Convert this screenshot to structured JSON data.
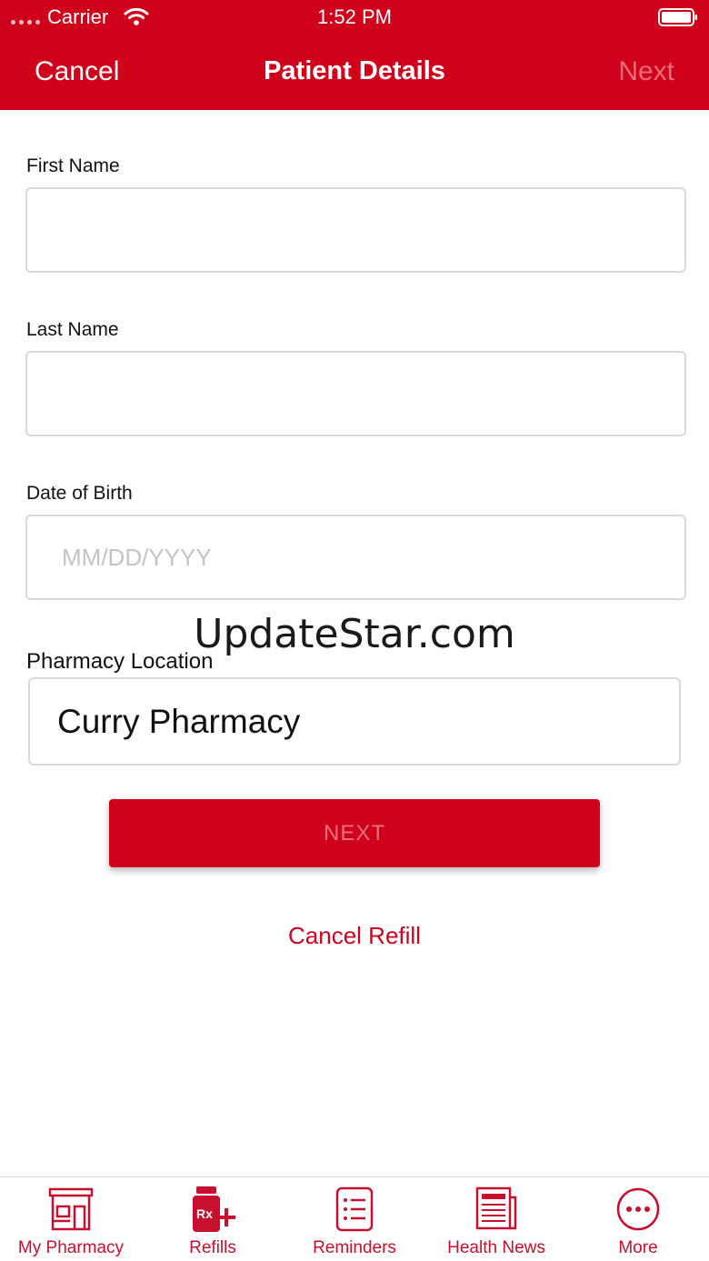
{
  "status_bar": {
    "carrier": "Carrier",
    "time": "1:52 PM"
  },
  "nav": {
    "cancel_label": "Cancel",
    "title": "Patient Details",
    "next_label": "Next"
  },
  "form": {
    "first_name": {
      "label": "First Name",
      "value": "",
      "placeholder": ""
    },
    "last_name": {
      "label": "Last Name",
      "value": "",
      "placeholder": ""
    },
    "dob": {
      "label": "Date of Birth",
      "value": "",
      "placeholder": "MM/DD/YYYY"
    },
    "pharmacy": {
      "label": "Pharmacy Location",
      "value": "Curry Pharmacy"
    }
  },
  "watermark": "UpdateStar.com",
  "actions": {
    "next_label": "NEXT",
    "cancel_refill_label": "Cancel Refill"
  },
  "tab_bar": {
    "items": [
      {
        "label": "My Pharmacy",
        "icon": "storefront-icon"
      },
      {
        "label": "Refills",
        "icon": "rx-bottle-icon"
      },
      {
        "label": "Reminders",
        "icon": "checklist-icon"
      },
      {
        "label": "Health News",
        "icon": "newspaper-icon"
      },
      {
        "label": "More",
        "icon": "more-dots-icon"
      }
    ]
  },
  "colors": {
    "brand_red": "#d0021b",
    "disabled_text": "#e8707c",
    "tab_red": "#c8102e"
  }
}
